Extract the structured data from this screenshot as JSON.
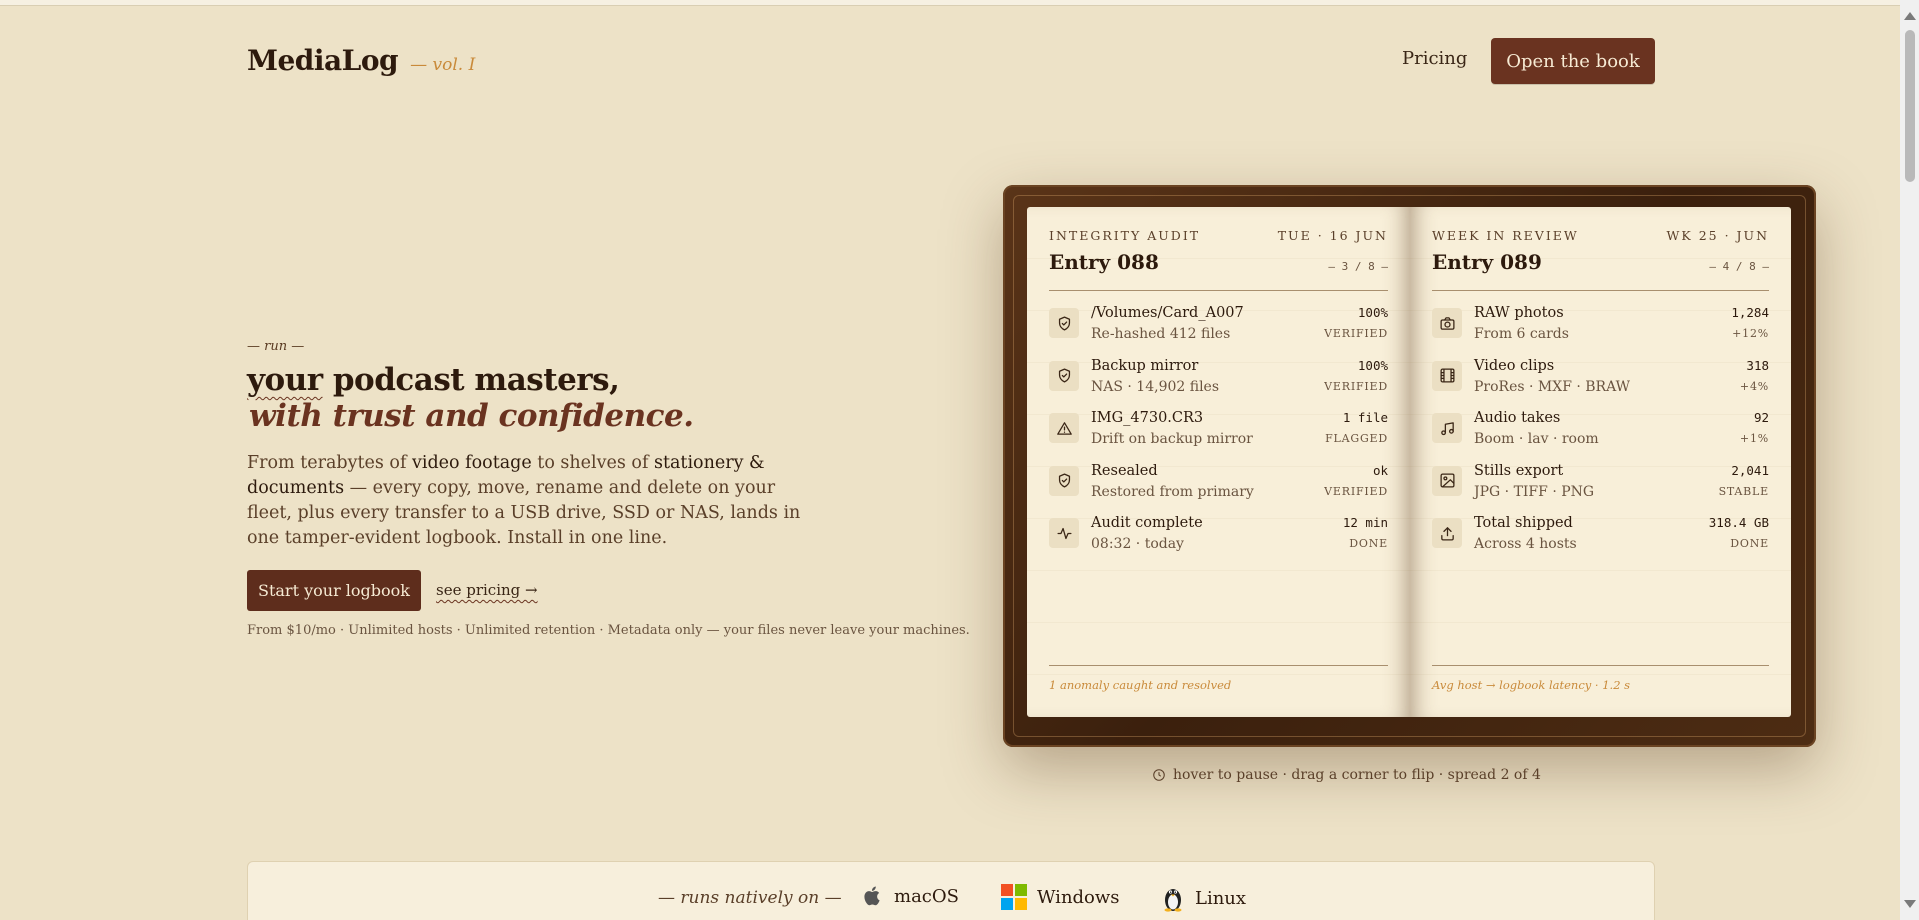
{
  "header": {
    "brand": "MediaLog",
    "volume": "— vol. I",
    "nav_pricing": "Pricing",
    "cta_open": "Open the book"
  },
  "hero": {
    "kicker": "— run —",
    "headline_line1_emph": "your",
    "headline_line1_rest": " podcast masters,",
    "headline_line2": "with trust and confidence.",
    "lede_parts": [
      "From terabytes of ",
      "video footage",
      " to shelves of ",
      "stationery & documents",
      " — every copy, move, rename and delete on your fleet, plus every transfer to a USB drive, SSD or NAS, lands in one tamper-evident logbook. Install in one line."
    ],
    "cta_start": "Start your logbook",
    "link_pricing": "see pricing →",
    "fineprint": "From $10/mo · Unlimited hosts · Unlimited retention · Metadata only — your files never leave your machines."
  },
  "book": {
    "left": {
      "eyebrow": "INTEGRITY AUDIT",
      "date": "TUE · 16 JUN",
      "title": "Entry 088",
      "folio": "– 3 / 8 –",
      "entries": [
        {
          "icon": "shield-check-icon",
          "title": "/Volumes/Card_A007",
          "sub": "Re-hashed 412 files",
          "value": "100%",
          "status": "VERIFIED"
        },
        {
          "icon": "shield-check-icon",
          "title": "Backup mirror",
          "sub": "NAS · 14,902 files",
          "value": "100%",
          "status": "VERIFIED"
        },
        {
          "icon": "warning-triangle-icon",
          "title": "IMG_4730.CR3",
          "sub": "Drift on backup mirror",
          "value": "1 file",
          "status": "FLAGGED"
        },
        {
          "icon": "shield-check-icon",
          "title": "Resealed",
          "sub": "Restored from primary",
          "value": "ok",
          "status": "VERIFIED"
        },
        {
          "icon": "activity-icon",
          "title": "Audit complete",
          "sub": "08:32 · today",
          "value": "12 min",
          "status": "DONE"
        }
      ],
      "footer": "1 anomaly caught and resolved"
    },
    "right": {
      "eyebrow": "WEEK IN REVIEW",
      "date": "WK 25 · JUN",
      "title": "Entry 089",
      "folio": "– 4 / 8 –",
      "entries": [
        {
          "icon": "camera-icon",
          "title": "RAW photos",
          "sub": "From 6 cards",
          "value": "1,284",
          "status": "+12%"
        },
        {
          "icon": "film-icon",
          "title": "Video clips",
          "sub": "ProRes · MXF · BRAW",
          "value": "318",
          "status": "+4%"
        },
        {
          "icon": "music-note-icon",
          "title": "Audio takes",
          "sub": "Boom · lav · room",
          "value": "92",
          "status": "+1%"
        },
        {
          "icon": "image-icon",
          "title": "Stills export",
          "sub": "JPG · TIFF · PNG",
          "value": "2,041",
          "status": "STABLE"
        },
        {
          "icon": "upload-icon",
          "title": "Total shipped",
          "sub": "Across 4 hosts",
          "value": "318.4 GB",
          "status": "DONE"
        }
      ],
      "footer": "Avg host → logbook latency · 1.2 s"
    },
    "hint": "hover to pause · drag a corner to flip · spread 2 of 4"
  },
  "platforms": {
    "label": "— runs natively on —",
    "os": [
      {
        "name": "macOS",
        "icon": "apple-icon"
      },
      {
        "name": "Windows",
        "icon": "windows-icon"
      },
      {
        "name": "Linux",
        "icon": "linux-penguin-icon"
      }
    ]
  },
  "colors": {
    "background": "#ede2c7",
    "accent": "#6a3320",
    "ink": "#2d1a0d",
    "gold": "#c98a3a",
    "leather": "#4a2a12"
  }
}
